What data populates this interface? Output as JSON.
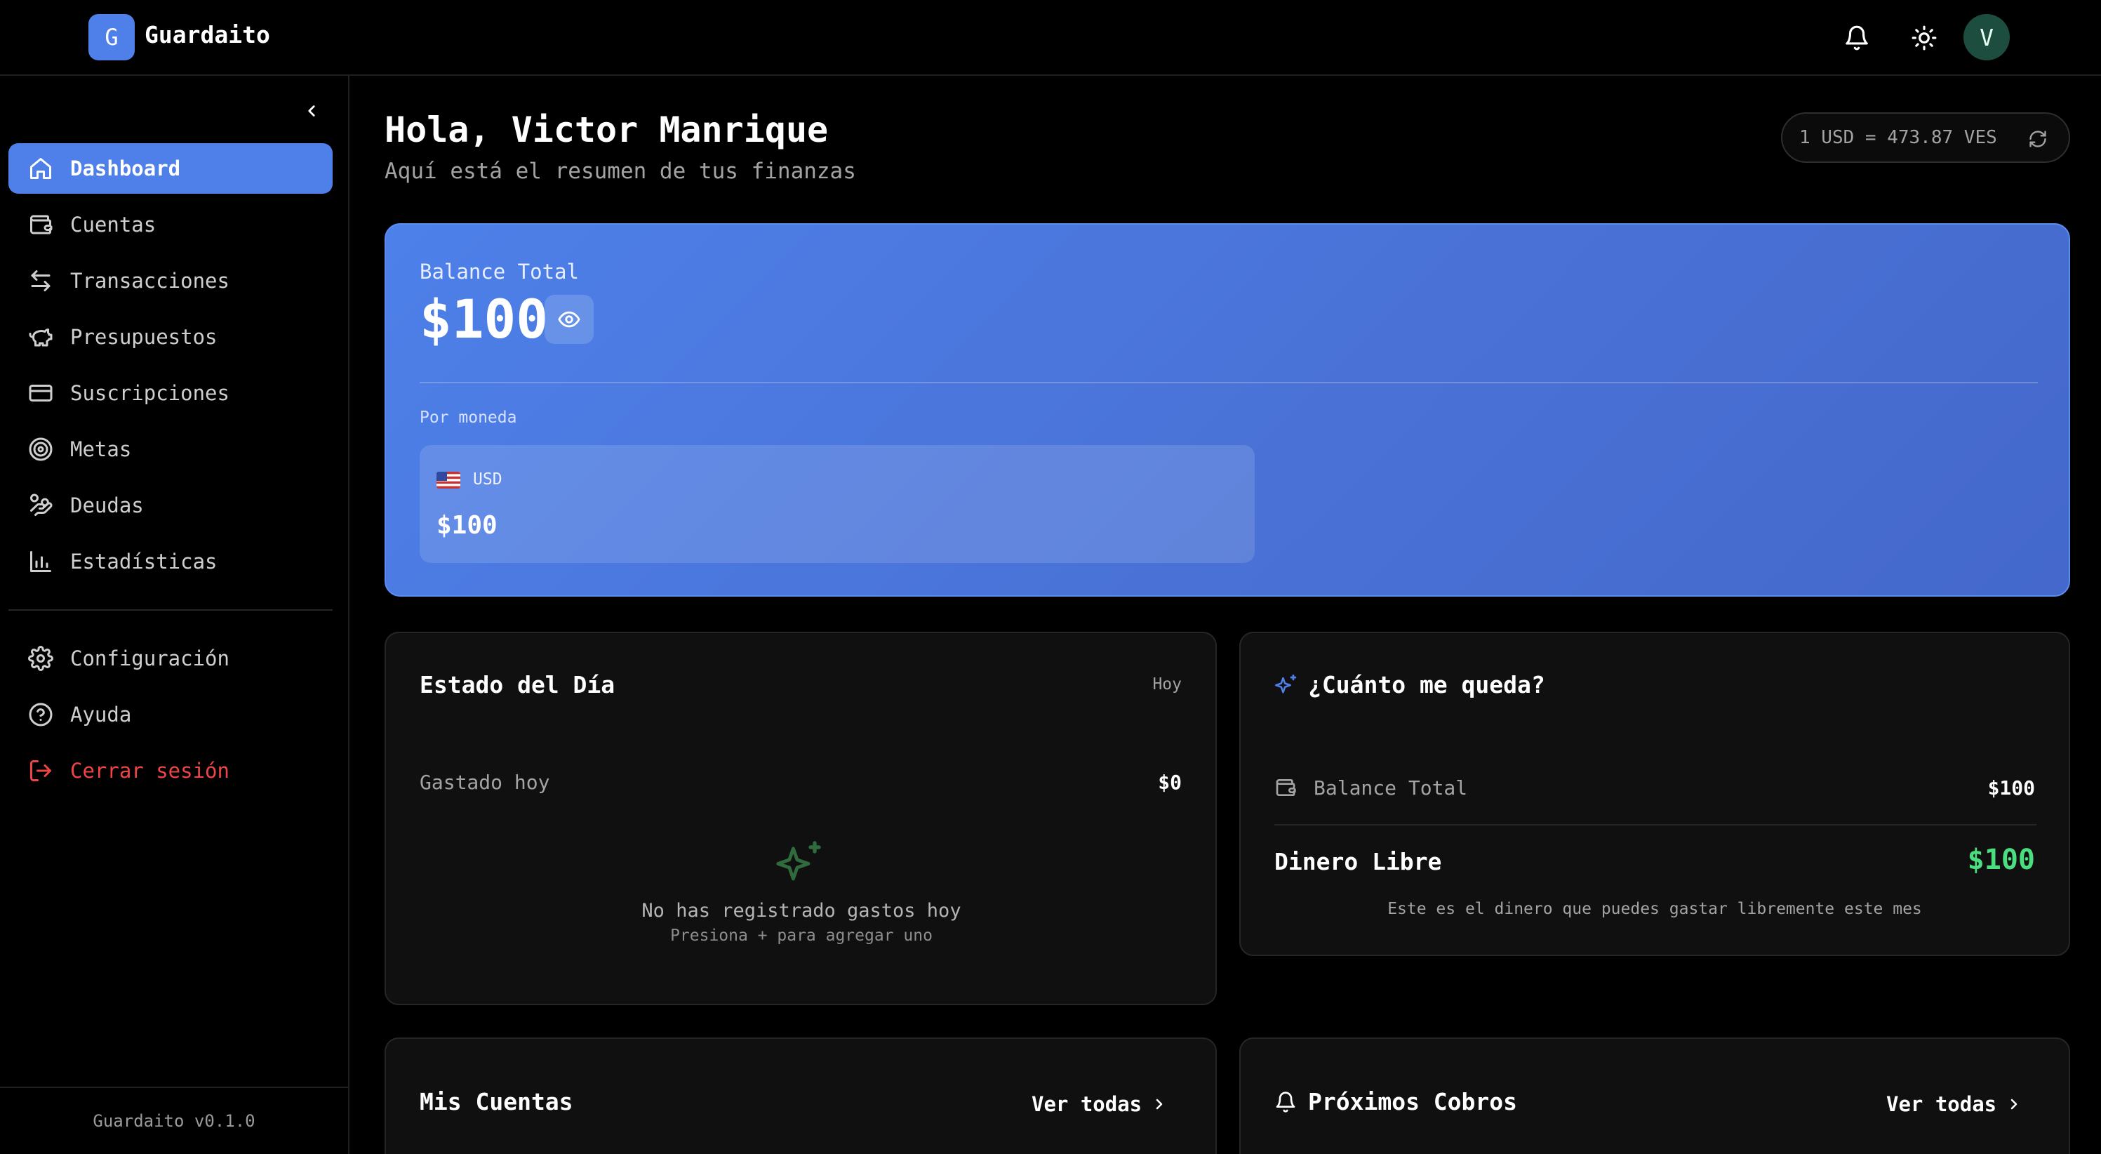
{
  "app": {
    "logo_letter": "G",
    "name": "Guardaito",
    "version": "Guardaito v0.1.0"
  },
  "header": {
    "avatar_letter": "V"
  },
  "sidebar": {
    "items": [
      {
        "label": "Dashboard"
      },
      {
        "label": "Cuentas"
      },
      {
        "label": "Transacciones"
      },
      {
        "label": "Presupuestos"
      },
      {
        "label": "Suscripciones"
      },
      {
        "label": "Metas"
      },
      {
        "label": "Deudas"
      },
      {
        "label": "Estadísticas"
      }
    ],
    "bottom_items": [
      {
        "label": "Configuración"
      },
      {
        "label": "Ayuda"
      },
      {
        "label": "Cerrar sesión"
      }
    ]
  },
  "main": {
    "greeting": "Hola, Victor Manrique",
    "subtitle": "Aquí está el resumen de tus finanzas",
    "exchange_rate": "1 USD = 473.87 VES"
  },
  "balance": {
    "label": "Balance Total",
    "amount": "$100",
    "by_currency_label": "Por moneda",
    "currency_code": "USD",
    "currency_amount": "$100"
  },
  "estado_dia": {
    "title": "Estado del Día",
    "period": "Hoy",
    "spent_label": "Gastado hoy",
    "spent_value": "$0",
    "empty_title": "No has registrado gastos hoy",
    "empty_sub": "Presiona + para agregar uno"
  },
  "cuanto_queda": {
    "title": "¿Cuánto me queda?",
    "balance_label": "Balance Total",
    "balance_value": "$100",
    "free_label": "Dinero Libre",
    "free_value": "$100",
    "note": "Este es el dinero que puedes gastar libremente este mes"
  },
  "mis_cuentas": {
    "title": "Mis Cuentas",
    "link": "Ver todas"
  },
  "proximos_cobros": {
    "title": "Próximos Cobros",
    "link": "Ver todas"
  },
  "colors": {
    "accent": "#4f7fe8",
    "danger": "#ef4444",
    "positive": "#4ade80"
  }
}
